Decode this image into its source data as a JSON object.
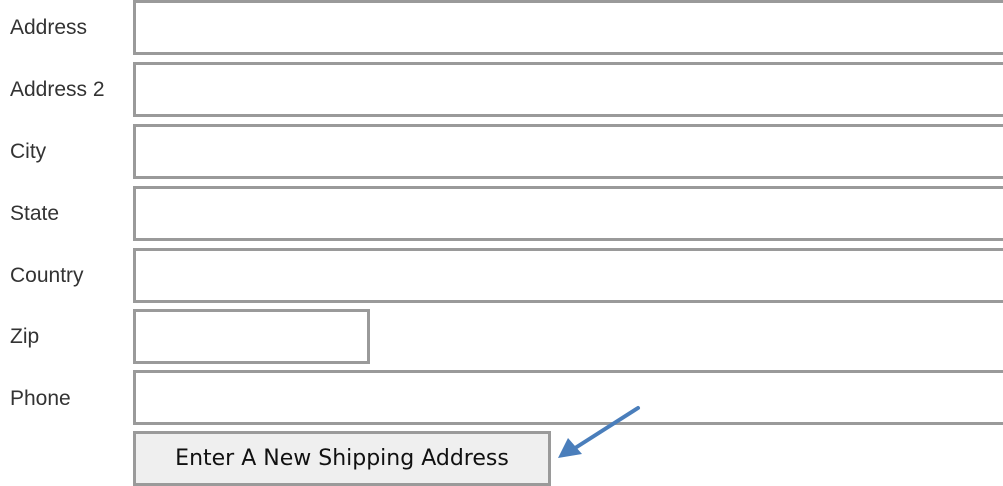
{
  "form": {
    "fields": [
      {
        "label": "Address",
        "value": "",
        "placeholder": ""
      },
      {
        "label": "Address 2",
        "value": "",
        "placeholder": ""
      },
      {
        "label": "City",
        "value": "",
        "placeholder": ""
      },
      {
        "label": "State",
        "value": "",
        "placeholder": ""
      },
      {
        "label": "Country",
        "value": "",
        "placeholder": ""
      },
      {
        "label": "Zip",
        "value": "",
        "placeholder": ""
      },
      {
        "label": "Phone",
        "value": "",
        "placeholder": ""
      }
    ],
    "submit_label": "Enter A New Shipping Address"
  },
  "annotation": {
    "arrow_color": "#4a7ebb"
  },
  "colors": {
    "input_border": "#9a9a9a",
    "button_background": "#efefef",
    "label_text": "#333333"
  }
}
